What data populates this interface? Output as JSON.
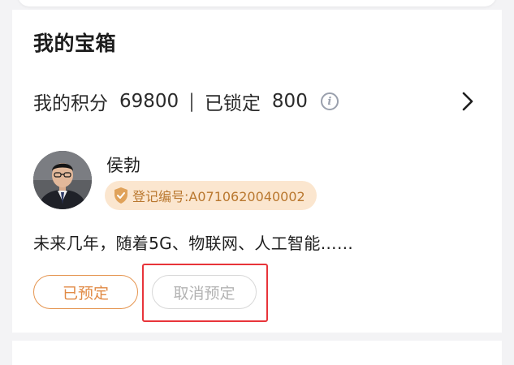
{
  "card": {
    "title": "我的宝箱",
    "points_label": "我的积分",
    "points_value": "69800",
    "separator": "|",
    "locked_label": "已锁定",
    "locked_value": "800",
    "info_icon": "info-icon",
    "chevron_icon": "chevron-right-icon"
  },
  "item": {
    "author": "侯勃",
    "avatar_icon": "avatar",
    "badge_icon": "shield-check-icon",
    "badge_text": "登记编号:A0710620040002",
    "description": "未来几年，随着5G、物联网、人工智能……"
  },
  "actions": {
    "reserved_label": "已预定",
    "cancel_label": "取消预定"
  },
  "colors": {
    "accent_orange": "#e18a45",
    "badge_bg": "#fbe6cf",
    "badge_text": "#b9772e",
    "disabled_text": "#b3b3b3",
    "highlight_red": "#e8343a",
    "page_bg": "#f3f3f5"
  }
}
